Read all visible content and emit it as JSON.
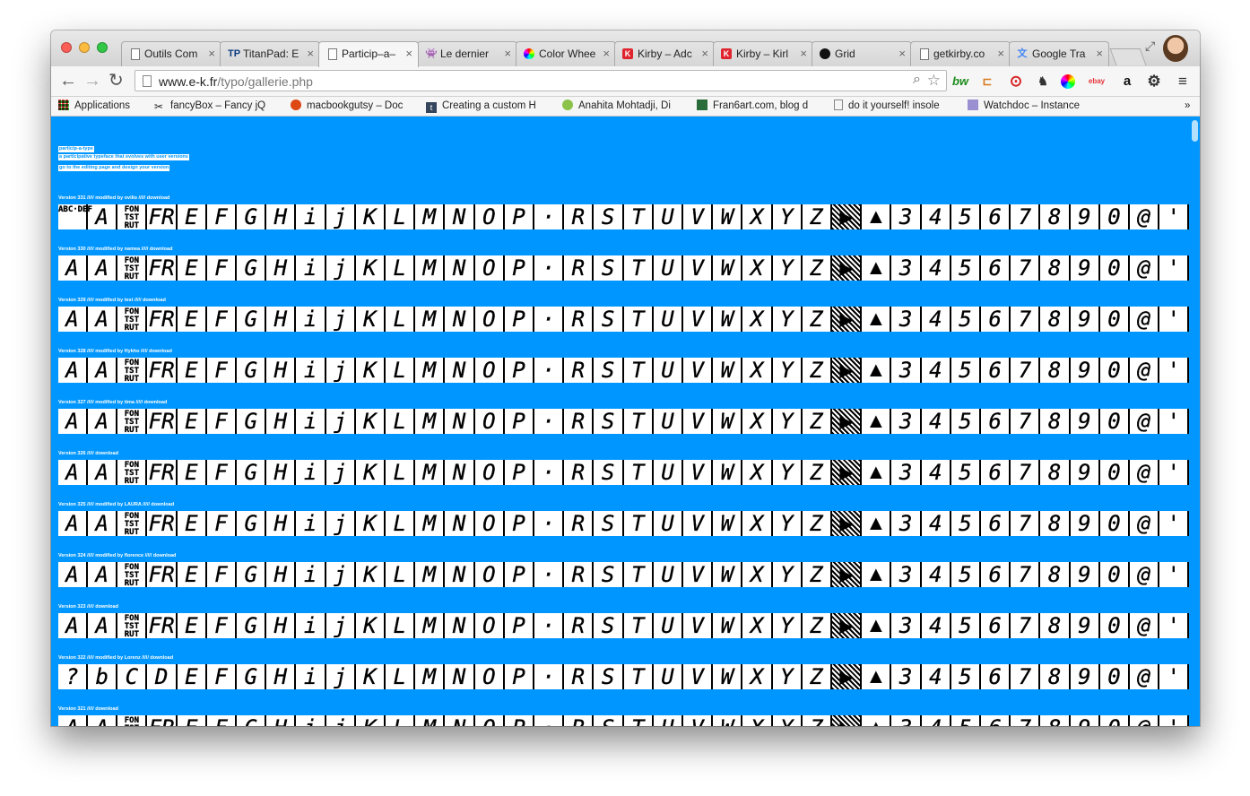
{
  "window": {
    "traffic_lights": [
      "close",
      "minimize",
      "zoom"
    ]
  },
  "tabs": [
    {
      "label": "Outils Com",
      "icon": "document-icon",
      "active": false
    },
    {
      "label": "TitanPad: E",
      "icon": "titanpad-icon",
      "active": false
    },
    {
      "label": "Particip–a–",
      "icon": "document-icon",
      "active": true
    },
    {
      "label": "Le dernier",
      "icon": "alien-icon",
      "active": false
    },
    {
      "label": "Color Whee",
      "icon": "color-wheel-icon",
      "active": false
    },
    {
      "label": "Kirby – Adc",
      "icon": "kirby-icon",
      "active": false
    },
    {
      "label": "Kirby – Kirl",
      "icon": "kirby-icon",
      "active": false
    },
    {
      "label": "Grid",
      "icon": "github-icon",
      "active": false
    },
    {
      "label": "getkirby.co",
      "icon": "document-icon",
      "active": false
    },
    {
      "label": "Google Tra",
      "icon": "google-translate-icon",
      "active": false
    }
  ],
  "toolbar": {
    "url_host": "www.e-k.fr",
    "url_path": "/typo/gallerie.php",
    "extensions": [
      "bw-extension-icon",
      "feedly-icon",
      "opera-icon",
      "evernote-icon",
      "colorpicker-icon",
      "ebay-icon",
      "amazon-icon",
      "settings-icon",
      "menu-icon"
    ],
    "ext_labels": {
      "bw": "bw",
      "ebay": "ebay",
      "amazon": "a"
    }
  },
  "bookmarks": [
    {
      "label": "Applications",
      "icon": "apps-grid-icon"
    },
    {
      "label": "fancyBox – Fancy jQ",
      "icon": "fancybox-icon"
    },
    {
      "label": "macbookgutsy – Doc",
      "icon": "ubuntu-icon"
    },
    {
      "label": "Creating a custom H",
      "icon": "tumblr-icon"
    },
    {
      "label": "Anahita Mohtadji, Di",
      "icon": "apple-icon"
    },
    {
      "label": "Fran6art.com, blog d",
      "icon": "fran6art-icon"
    },
    {
      "label": "do it yourself! insole",
      "icon": "document-icon"
    },
    {
      "label": "Watchdoc – Instance",
      "icon": "watchdoc-icon"
    }
  ],
  "page": {
    "intro": [
      "particip-a-type",
      "a participative typeface that evolves with user versions",
      "go to the editing page and design your version"
    ],
    "versions": [
      {
        "label": "Version 331 ///// modified by ovilio ///// download",
        "first": [
          "ABC·DEF",
          "A",
          "FON TST RUT",
          "FR"
        ]
      },
      {
        "label": "Version 330 ///// modified by namea ///// download",
        "first": [
          "A",
          "A",
          "FON TST RUT",
          "FR"
        ]
      },
      {
        "label": "Version 329 ///// modified by test ///// download",
        "first": [
          "A",
          "A",
          "FON TST RUT",
          "FR"
        ]
      },
      {
        "label": "Version 328 ///// modified by Hykho ///// download",
        "first": [
          "A",
          "A",
          "FON TST RUT",
          "FR"
        ]
      },
      {
        "label": "Version 327 ///// modified by tima ///// download",
        "first": [
          "A",
          "A",
          "FON TST RUT",
          "FR"
        ]
      },
      {
        "label": "Version 326 ///// download",
        "first": [
          "A",
          "A",
          "FON TST RUT",
          "FR"
        ]
      },
      {
        "label": "Version 325 ///// modified by LAURA ///// download",
        "first": [
          "A",
          "A",
          "FON TST RUT",
          "FR"
        ]
      },
      {
        "label": "Version 324 ///// modified by florence ///// download",
        "first": [
          "A",
          "A",
          "FON TST RUT",
          "FR"
        ]
      },
      {
        "label": "Version 323 ///// download",
        "first": [
          "A",
          "A",
          "FON TST RUT",
          "FR"
        ]
      },
      {
        "label": "Version 322 ///// modified by Lorenz ///// download",
        "first": [
          "?",
          "b",
          "C",
          "D"
        ]
      },
      {
        "label": "Version 321 ///// download",
        "first": [
          "A",
          "A",
          "FON TST RUT",
          "FR"
        ]
      }
    ],
    "glyphs": [
      "E",
      "F",
      "G",
      "H",
      "i",
      "j",
      "K",
      "L",
      "M",
      "N",
      "O",
      "P",
      "·",
      "R",
      "S",
      "T",
      "U",
      "V",
      "W",
      "X",
      "Y",
      "Z",
      "▶",
      "▲",
      "3",
      "4",
      "5",
      "6",
      "7",
      "8",
      "9",
      "0",
      "@",
      "'"
    ]
  }
}
